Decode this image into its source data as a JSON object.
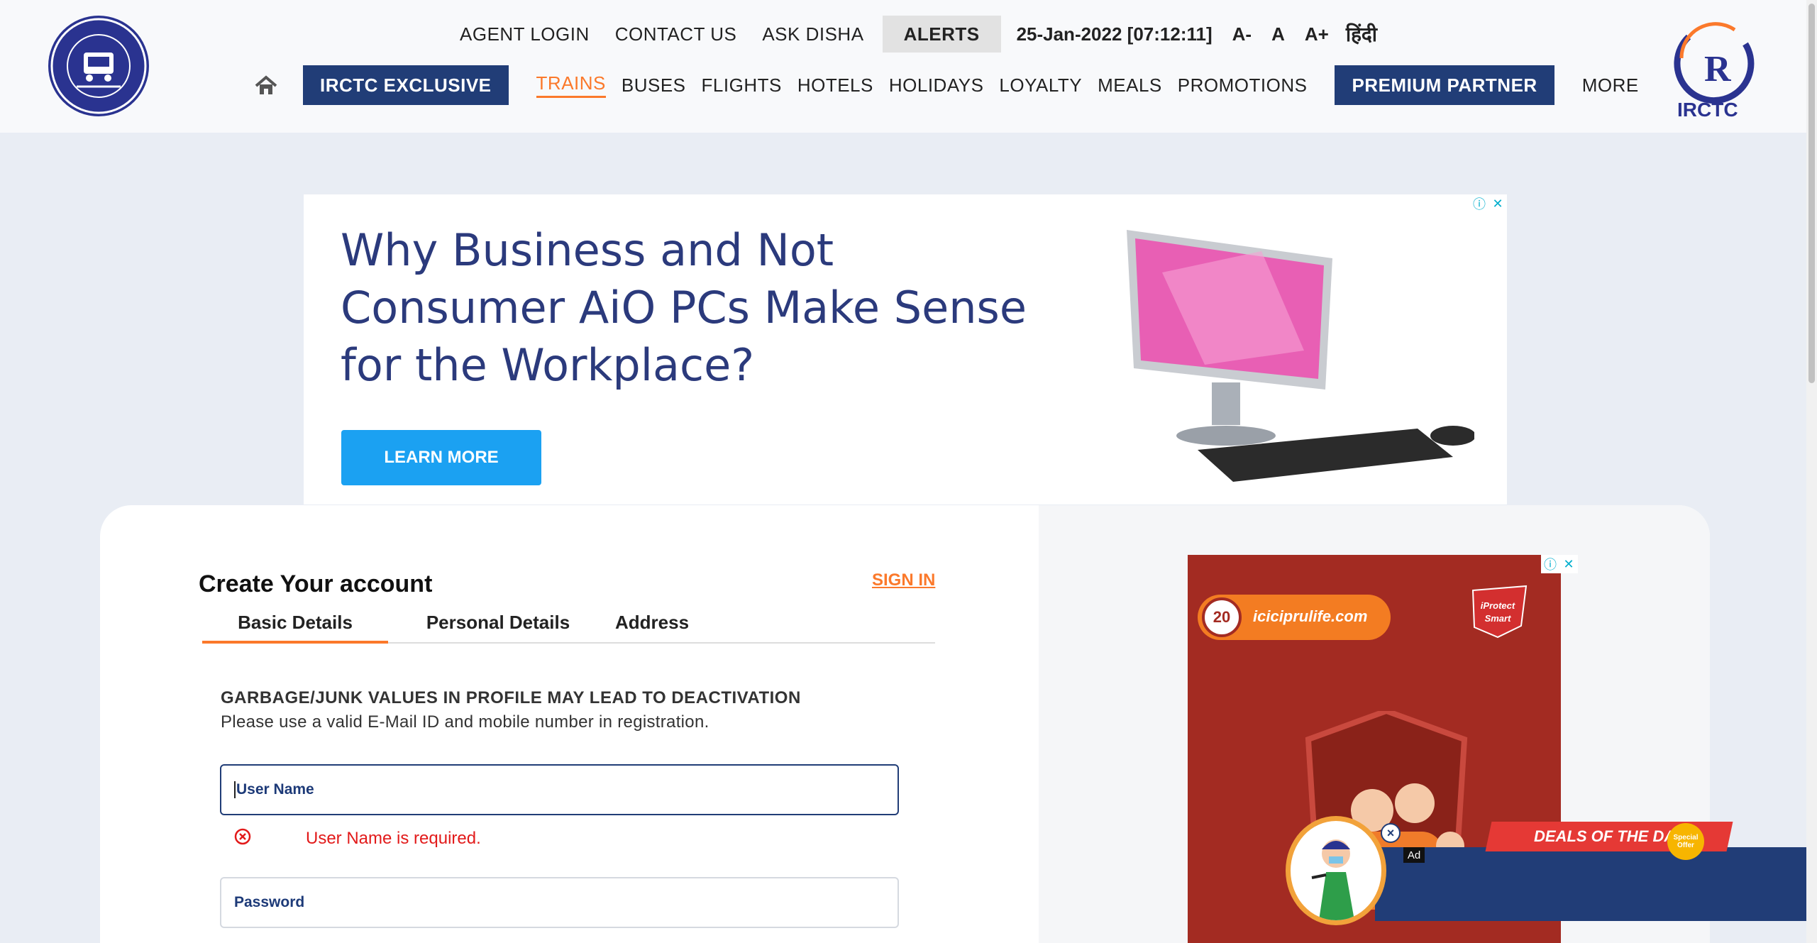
{
  "header": {
    "top_links": [
      "AGENT LOGIN",
      "CONTACT US",
      "ASK DISHA"
    ],
    "alerts_label": "ALERTS",
    "datetime": "25-Jan-2022 [07:12:11]",
    "font_small": "A-",
    "font_normal": "A",
    "font_large": "A+",
    "language": "हिंदी",
    "irctc_logo_text": "IRCTC",
    "railways_logo_icon": "indian-railways-emblem"
  },
  "nav": {
    "home_icon": "home-icon",
    "exclusive": "IRCTC EXCLUSIVE",
    "items": [
      "TRAINS",
      "BUSES",
      "FLIGHTS",
      "HOTELS",
      "HOLIDAYS",
      "LOYALTY",
      "MEALS",
      "PROMOTIONS"
    ],
    "active": "TRAINS",
    "premium": "PREMIUM PARTNER",
    "more": "MORE"
  },
  "ad_banner": {
    "headline": "Why Business and Not Consumer AiO PCs Make Sense for the Workplace?",
    "cta": "LEARN MORE",
    "info_icon": "ⓘ",
    "close_icon": "✕"
  },
  "form": {
    "title": "Create Your account",
    "sign_in": "SIGN IN",
    "tabs": [
      "Basic Details",
      "Personal Details",
      "Address"
    ],
    "active_tab": "Basic Details",
    "warning": "GARBAGE/JUNK VALUES IN PROFILE MAY LEAD TO DEACTIVATION",
    "note": "Please use a valid E-Mail ID and mobile number in registration.",
    "username_placeholder": "User Name",
    "username_error": "User Name is required.",
    "password_placeholder": "Password"
  },
  "side_ad": {
    "badge": "20",
    "site": "iciciprulife.com",
    "product": "iProtect Smart"
  },
  "deals": {
    "label": "DEALS OF THE DAY",
    "badge": "Special Offer",
    "ad_tag": "Ad"
  },
  "colors": {
    "brand_blue": "#213d77",
    "accent_orange": "#fb792b",
    "error_red": "#e21a1a",
    "cta_blue": "#1ba1f2"
  }
}
